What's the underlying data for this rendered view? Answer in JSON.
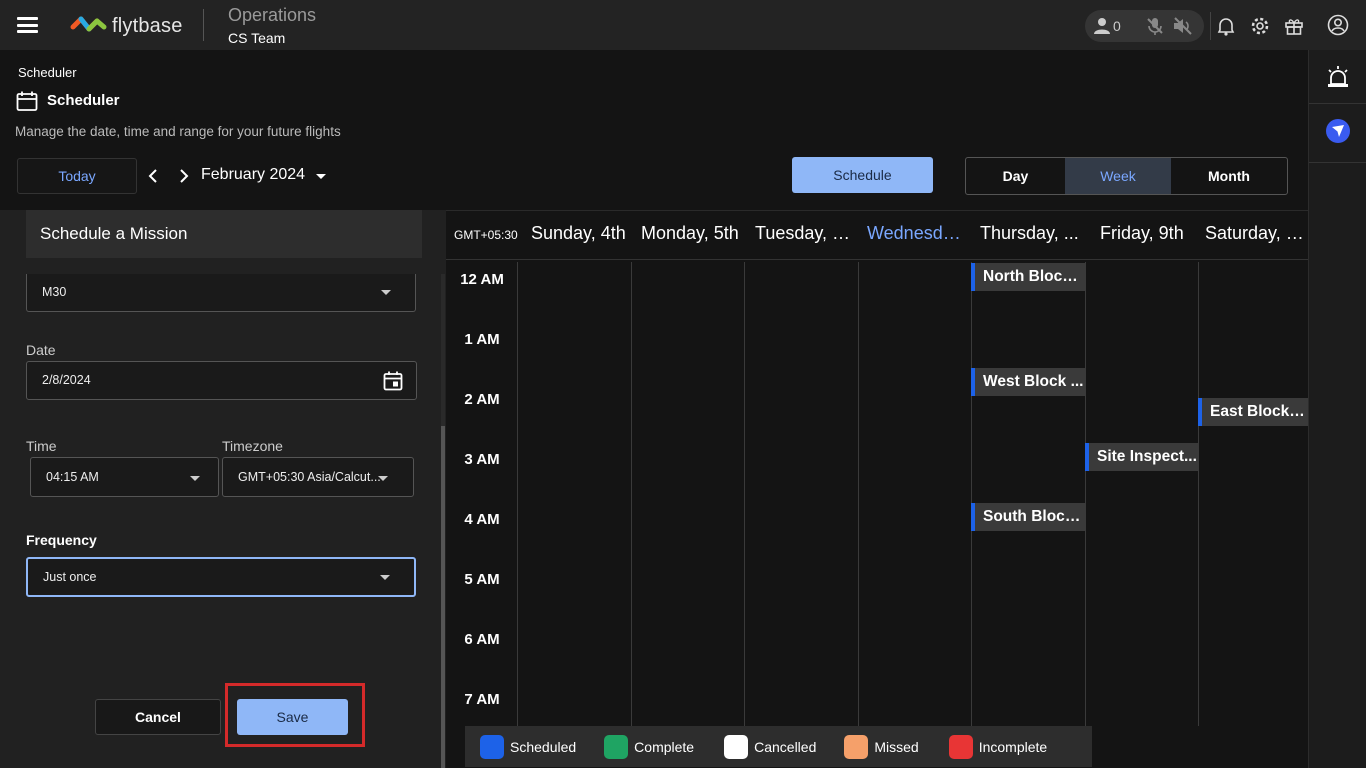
{
  "topbar": {
    "brand": "flytbase",
    "workspace_title": "Operations",
    "workspace_sub": "CS Team",
    "online_count": "0"
  },
  "header": {
    "breadcrumb": "Scheduler",
    "title": "Scheduler",
    "description": "Manage the date, time and range for your future flights",
    "today_label": "Today",
    "month_label": "February 2024",
    "schedule_label": "Schedule",
    "views": [
      "Day",
      "Week",
      "Month"
    ],
    "active_view": "Week"
  },
  "form": {
    "panel_title": "Schedule a Mission",
    "drone_value": "M30",
    "date_label": "Date",
    "date_value": "2/8/2024",
    "time_label": "Time",
    "time_value": "04:15 AM",
    "timezone_label": "Timezone",
    "timezone_value": "GMT+05:30 Asia/Calcut...",
    "frequency_label": "Frequency",
    "frequency_value": "Just once",
    "cancel_label": "Cancel",
    "save_label": "Save"
  },
  "calendar": {
    "timezone": "GMT+05:30",
    "days": [
      "Sunday, 4th",
      "Monday, 5th",
      "Tuesday, 6...",
      "Wednesda...",
      "Thursday, ...",
      "Friday, 9th",
      "Saturday, 1..."
    ],
    "hours": [
      "12 AM",
      "1 AM",
      "2 AM",
      "3 AM",
      "4 AM",
      "5 AM",
      "6 AM",
      "7 AM"
    ],
    "events": [
      "North Block ...",
      "West Block ...",
      "East Block P...",
      "Site Inspect...",
      "South Block..."
    ]
  },
  "legend": [
    {
      "label": "Scheduled",
      "color": "#1d62e8"
    },
    {
      "label": "Complete",
      "color": "#1fa463"
    },
    {
      "label": "Cancelled",
      "color": "#ffffff"
    },
    {
      "label": "Missed",
      "color": "#f5a06a"
    },
    {
      "label": "Incomplete",
      "color": "#e83535"
    }
  ]
}
